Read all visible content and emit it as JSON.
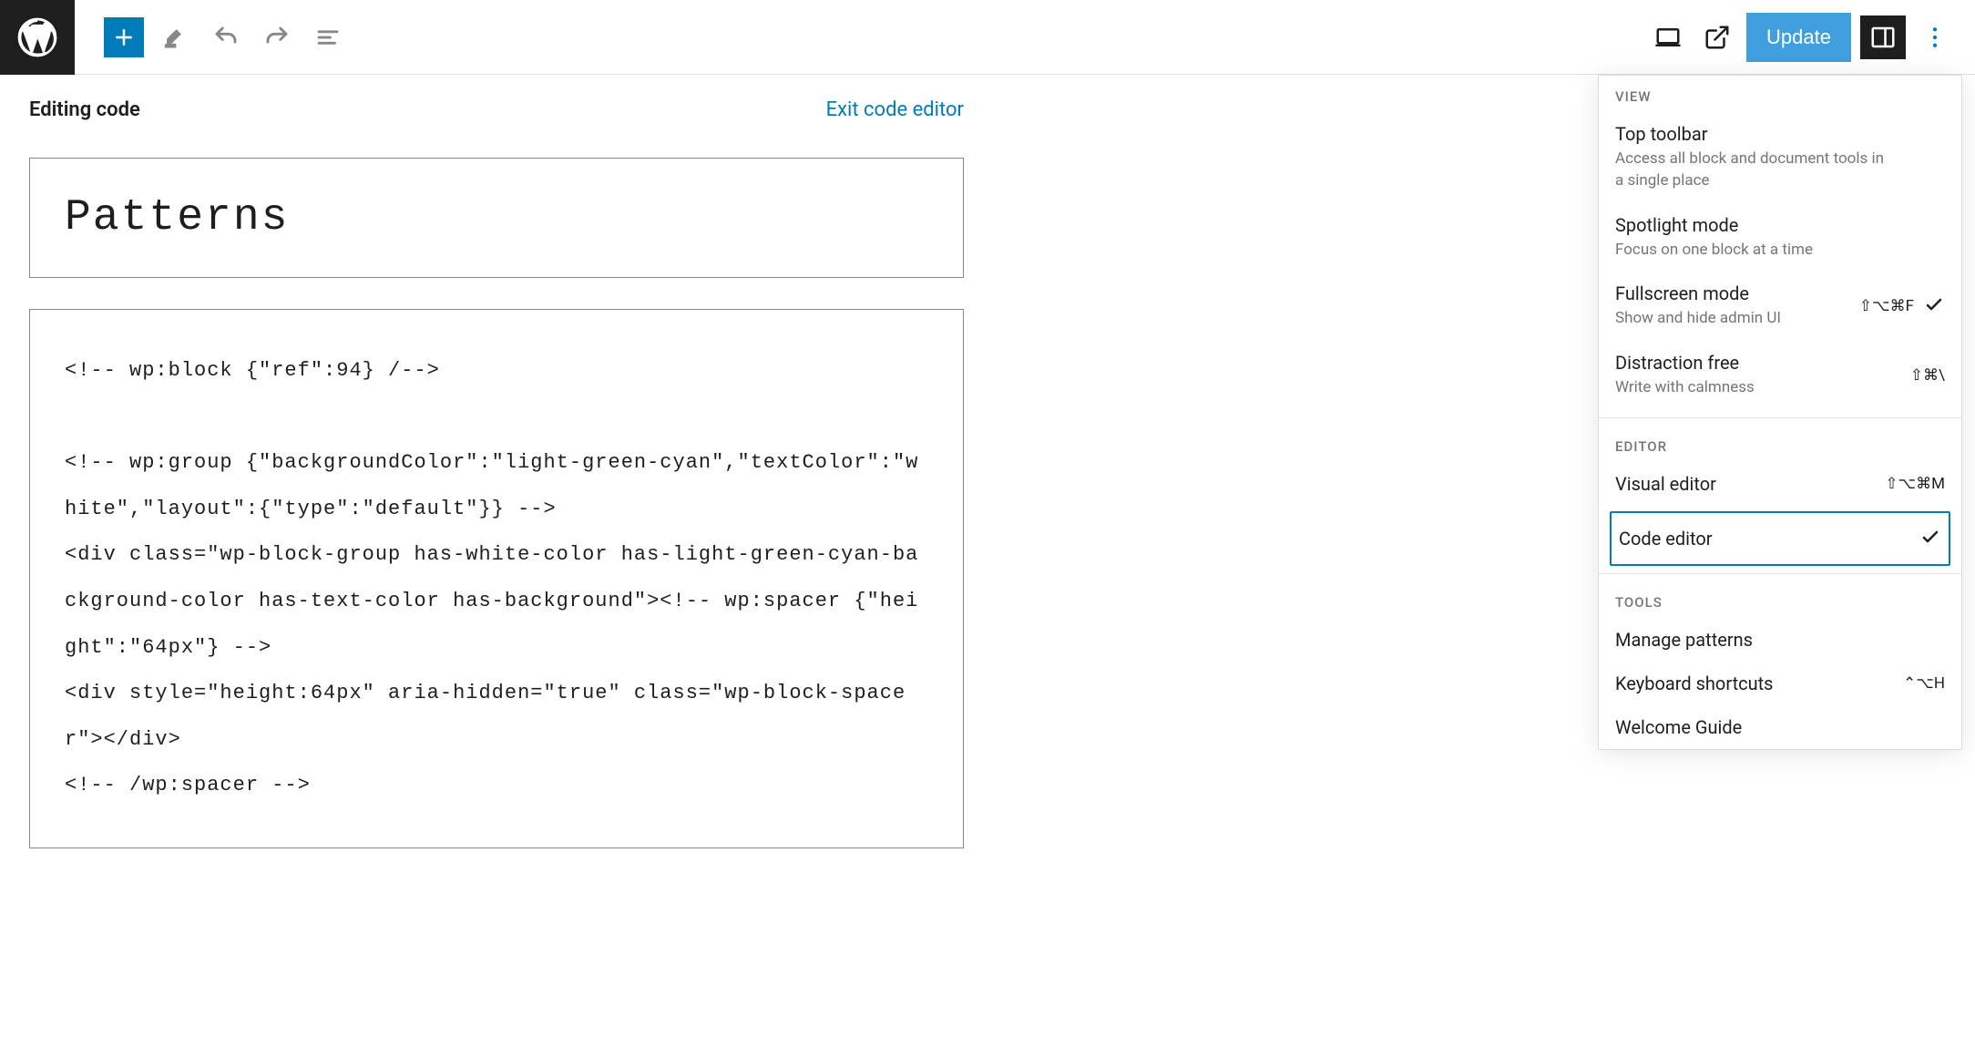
{
  "topbar": {
    "update_label": "Update"
  },
  "editor": {
    "editing_label": "Editing code",
    "exit_label": "Exit code editor",
    "post_title": "Patterns",
    "code_content": "<!-- wp:block {\"ref\":94} /-->\n\n<!-- wp:group {\"backgroundColor\":\"light-green-cyan\",\"textColor\":\"white\",\"layout\":{\"type\":\"default\"}} -->\n<div class=\"wp-block-group has-white-color has-light-green-cyan-background-color has-text-color has-background\"><!-- wp:spacer {\"height\":\"64px\"} -->\n<div style=\"height:64px\" aria-hidden=\"true\" class=\"wp-block-spacer\"></div>\n<!-- /wp:spacer -->"
  },
  "options": {
    "section_view": "VIEW",
    "top_toolbar": {
      "title": "Top toolbar",
      "desc": "Access all block and document tools in a single place"
    },
    "spotlight": {
      "title": "Spotlight mode",
      "desc": "Focus on one block at a time"
    },
    "fullscreen": {
      "title": "Fullscreen mode",
      "desc": "Show and hide admin UI",
      "shortcut": "⇧⌥⌘F"
    },
    "distraction": {
      "title": "Distraction free",
      "desc": "Write with calmness",
      "shortcut": "⇧⌘\\"
    },
    "section_editor": "EDITOR",
    "visual_editor": {
      "title": "Visual editor",
      "shortcut": "⇧⌥⌘M"
    },
    "code_editor": {
      "title": "Code editor"
    },
    "section_tools": "TOOLS",
    "manage_patterns": {
      "title": "Manage patterns"
    },
    "keyboard_shortcuts": {
      "title": "Keyboard shortcuts",
      "shortcut": "⌃⌥H"
    },
    "welcome_guide": {
      "title": "Welcome Guide"
    }
  }
}
